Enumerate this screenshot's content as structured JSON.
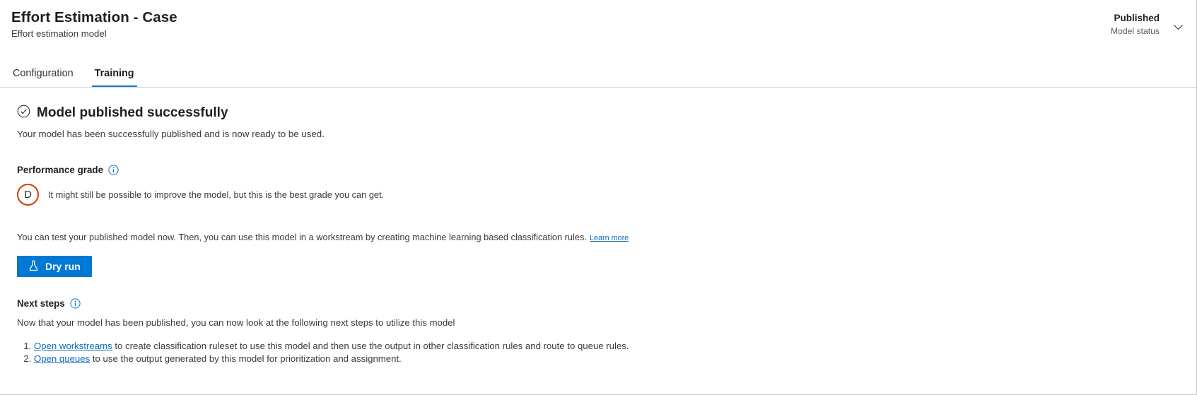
{
  "header": {
    "title": "Effort Estimation - Case",
    "subtitle": "Effort estimation model",
    "status_value": "Published",
    "status_label": "Model status",
    "chevron_icon": "chevron-down-icon"
  },
  "tabs": [
    {
      "label": "Configuration",
      "active": false
    },
    {
      "label": "Training",
      "active": true
    }
  ],
  "success": {
    "icon": "checkmark-circle-icon",
    "title": "Model published successfully",
    "description": "Your model has been successfully published and is now ready to be used."
  },
  "performance": {
    "label": "Performance grade",
    "info_icon": "info-icon",
    "grade": "D",
    "grade_description": "It might still be possible to improve the model, but this is the best grade you can get."
  },
  "test": {
    "text": "You can test your published model now. Then, you can use this model in a workstream by creating machine learning based classification rules.",
    "learn_more": "Learn more"
  },
  "dry_run": {
    "label": "Dry run",
    "icon": "flask-icon"
  },
  "next_steps": {
    "label": "Next steps",
    "info_icon": "info-icon",
    "description": "Now that your model has been published, you can now look at the following next steps to utilize this model",
    "items": [
      {
        "link": "Open workstreams",
        "text": " to create classification ruleset to use this model and then use the output in other classification rules and route to queue rules."
      },
      {
        "link": "Open queues",
        "text": " to use the output generated by this model for prioritization and assignment."
      }
    ]
  },
  "colors": {
    "accent": "#0078d4",
    "link": "#0f6cbd",
    "grade_border": "#d83b01"
  }
}
